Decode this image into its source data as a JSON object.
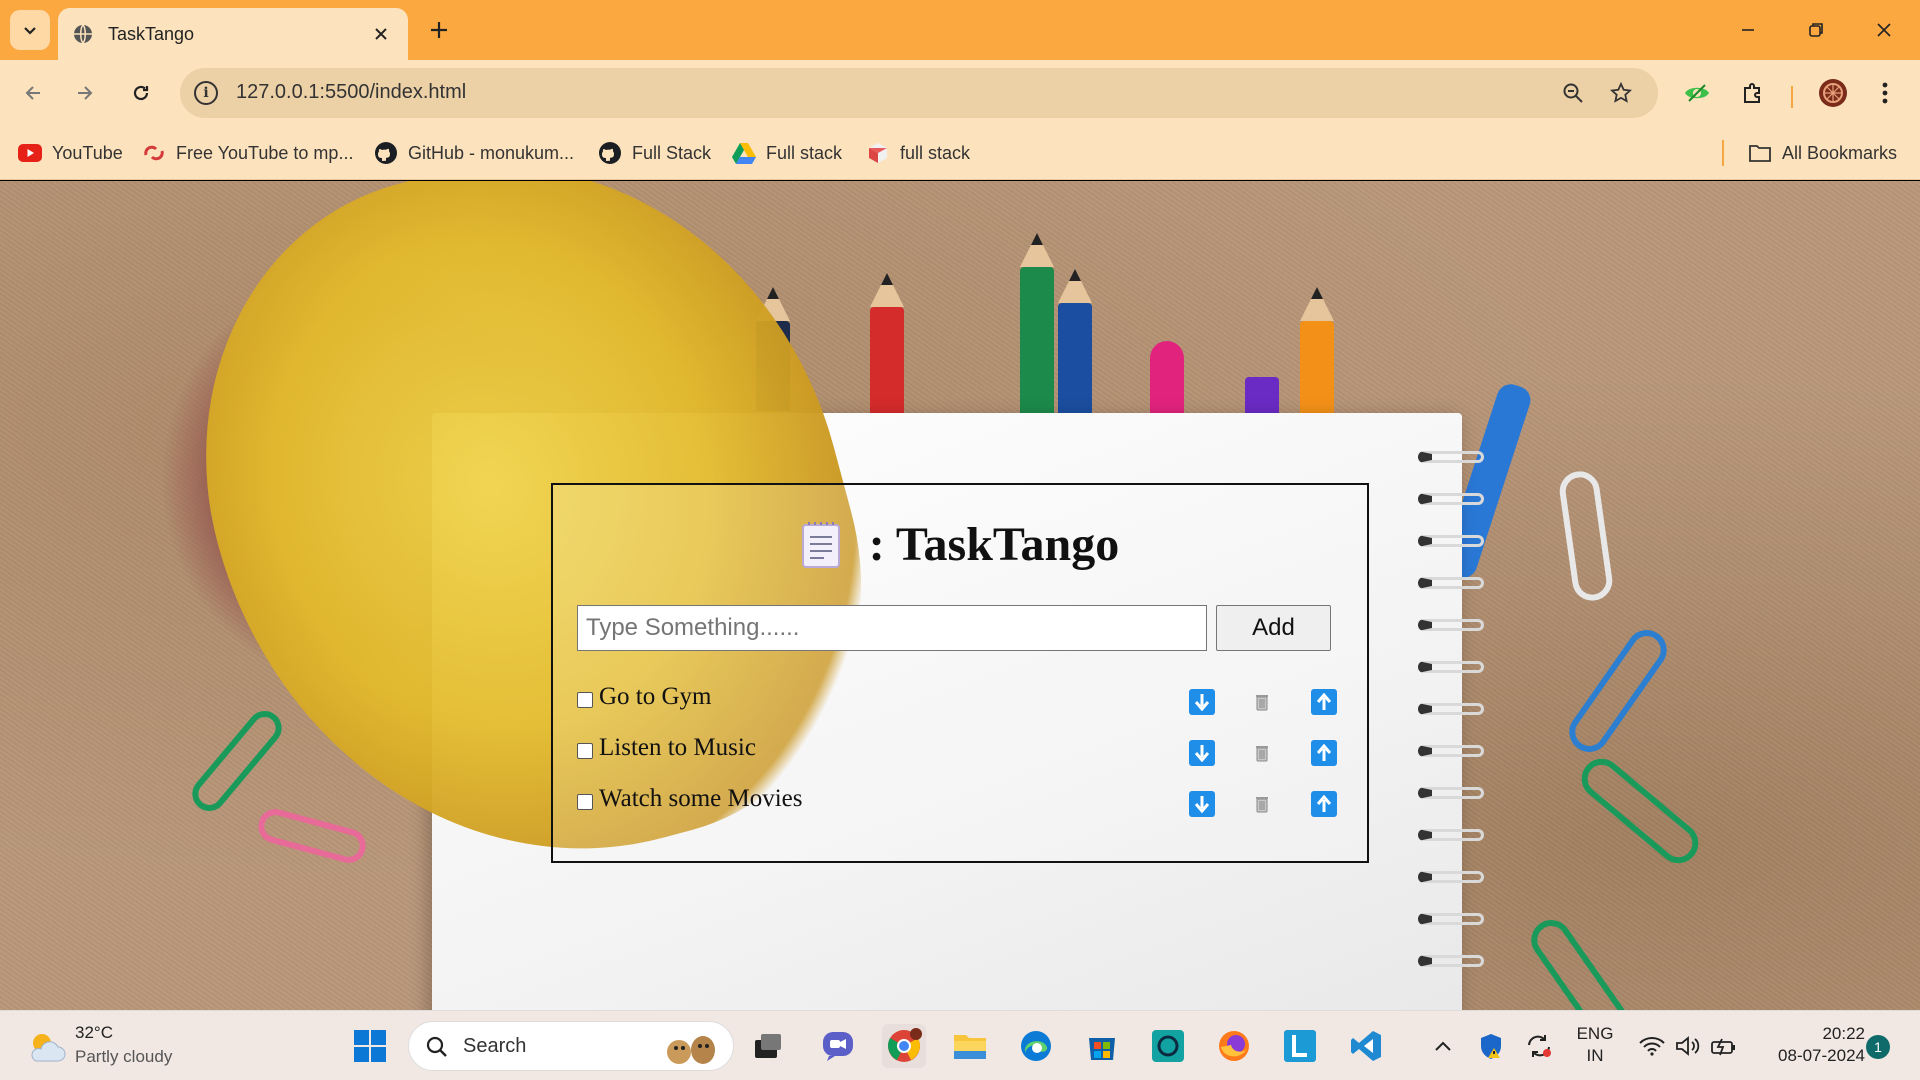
{
  "browser": {
    "tab": {
      "title": "TaskTango",
      "favicon": "globe-icon"
    },
    "address": {
      "url": "127.0.0.1:5500/index.html"
    },
    "bookmarks": [
      {
        "label": "YouTube",
        "icon": "youtube-icon"
      },
      {
        "label": "Free YouTube to mp...",
        "icon": "converter-icon"
      },
      {
        "label": "GitHub - monukum...",
        "icon": "github-icon"
      },
      {
        "label": "Full Stack",
        "icon": "github-icon"
      },
      {
        "label": "Full stack",
        "icon": "google-drive-icon"
      },
      {
        "label": "full stack",
        "icon": "cube-icon"
      }
    ],
    "all_bookmarks": "All Bookmarks",
    "accent_color": "#fca840"
  },
  "app": {
    "title": ": TaskTango",
    "input_placeholder": "Type Something......",
    "add_label": "Add",
    "tasks": [
      {
        "text": "Go to Gym",
        "checked": false
      },
      {
        "text": "Listen to Music",
        "checked": false
      },
      {
        "text": "Watch some Movies",
        "checked": false
      }
    ],
    "button_color": "#1e8ee8"
  },
  "taskbar": {
    "weather": {
      "temp": "32°C",
      "desc": "Partly cloudy"
    },
    "search_label": "Search",
    "language": {
      "line1": "ENG",
      "line2": "IN"
    },
    "clock": {
      "time": "20:22",
      "date": "08-07-2024"
    },
    "notifications": "1"
  }
}
